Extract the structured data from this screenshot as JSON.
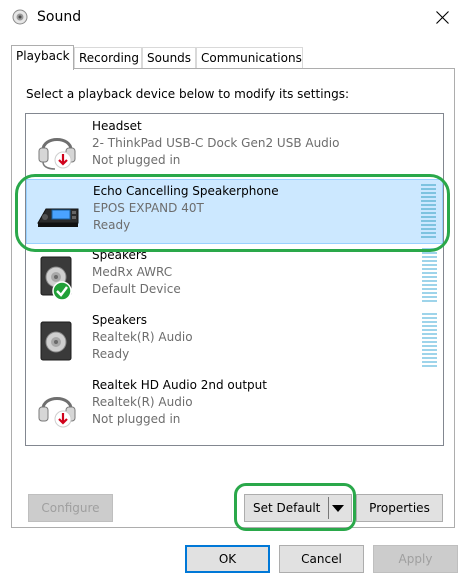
{
  "window": {
    "title": "Sound",
    "icon": "speaker-app-icon"
  },
  "tabs": [
    {
      "label": "Playback"
    },
    {
      "label": "Recording"
    },
    {
      "label": "Sounds"
    },
    {
      "label": "Communications"
    }
  ],
  "active_tab": "Playback",
  "instruction": "Select a playback device below to modify its settings:",
  "devices": [
    {
      "name": "Headset",
      "detail": "2- ThinkPad USB-C Dock Gen2 USB Audio",
      "status": "Not plugged in",
      "icon": "headset-icon",
      "badge": "unplugged-arrow-icon"
    },
    {
      "name": "Echo Cancelling Speakerphone",
      "detail": "EPOS EXPAND 40T",
      "status": "Ready",
      "icon": "speakerphone-icon",
      "selected": true
    },
    {
      "name": "Speakers",
      "detail": "MedRx AWRC",
      "status": "Default Device",
      "icon": "speaker-icon",
      "badge": "default-check-icon"
    },
    {
      "name": "Speakers",
      "detail": "Realtek(R) Audio",
      "status": "Ready",
      "icon": "speaker-icon"
    },
    {
      "name": "Realtek HD Audio 2nd output",
      "detail": "Realtek(R) Audio",
      "status": "Not plugged in",
      "icon": "headset-icon",
      "badge": "unplugged-arrow-icon"
    }
  ],
  "buttons": {
    "configure": "Configure",
    "set_default": "Set Default",
    "properties": "Properties",
    "ok": "OK",
    "cancel": "Cancel",
    "apply": "Apply"
  },
  "colors": {
    "selection": "#cce8ff",
    "highlight_annotation": "#2aa84a",
    "accent": "#0078d7"
  }
}
